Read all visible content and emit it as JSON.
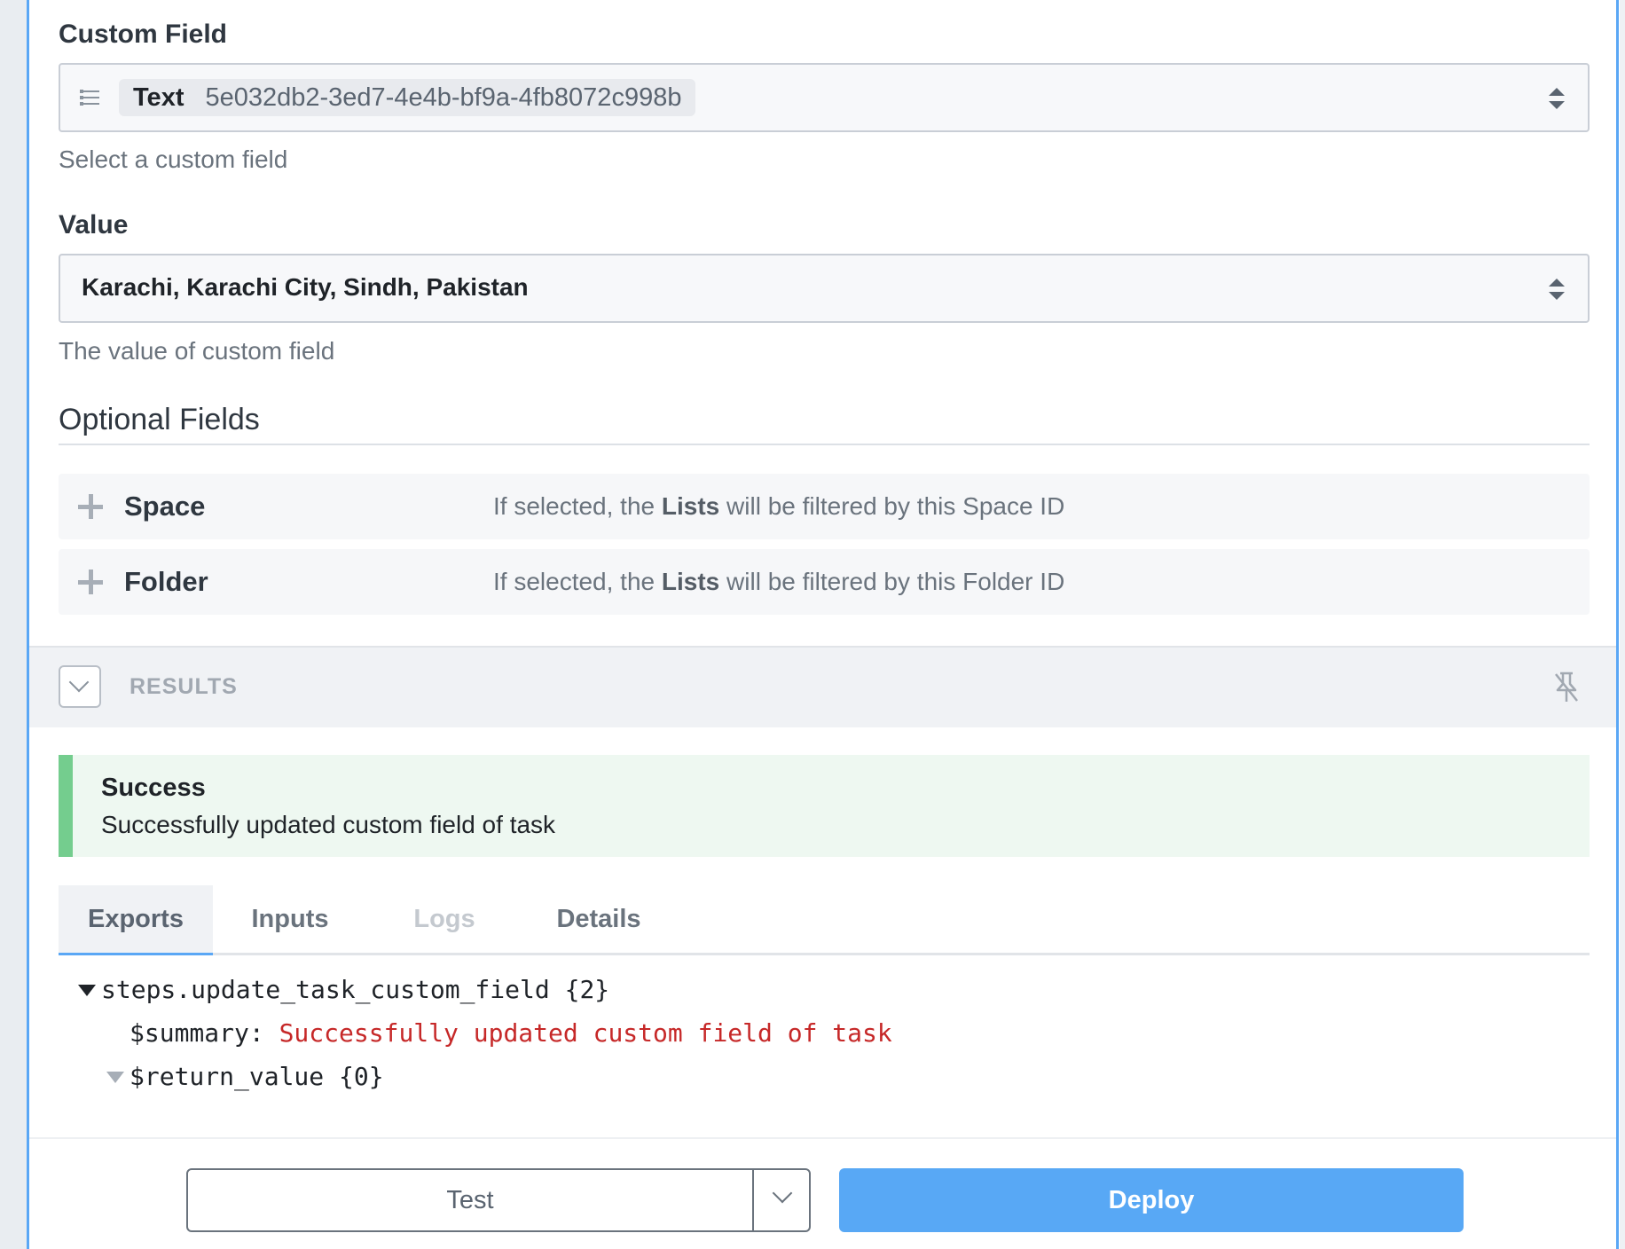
{
  "custom_field": {
    "label": "Custom Field",
    "chip_type": "Text",
    "chip_id": "5e032db2-3ed7-4e4b-bf9a-4fb8072c998b",
    "help": "Select a custom field"
  },
  "value_field": {
    "label": "Value",
    "value": "Karachi, Karachi City, Sindh, Pakistan",
    "help": "The value of custom field"
  },
  "optional": {
    "title": "Optional Fields",
    "rows": [
      {
        "label": "Space",
        "desc_before": "If selected, the ",
        "desc_bold": "Lists",
        "desc_after": " will be filtered by this Space ID"
      },
      {
        "label": "Folder",
        "desc_before": "If selected, the ",
        "desc_bold": "Lists",
        "desc_after": " will be filtered by this Folder ID"
      }
    ]
  },
  "results": {
    "label": "RESULTS",
    "status_title": "Success",
    "status_message": "Successfully updated custom field of task"
  },
  "tabs": [
    "Exports",
    "Inputs",
    "Logs",
    "Details"
  ],
  "exports": {
    "root": "steps.update_task_custom_field {2}",
    "summary_key": "$summary: ",
    "summary_value": "Successfully updated custom field of task",
    "return_value": "$return_value {0}"
  },
  "footer": {
    "test_label": "Test",
    "deploy_label": "Deploy"
  },
  "colors": {
    "accent_blue": "#58a8f5",
    "success_green": "#74cd8e",
    "success_bg": "#eef8f1",
    "string_red": "#c62828"
  }
}
